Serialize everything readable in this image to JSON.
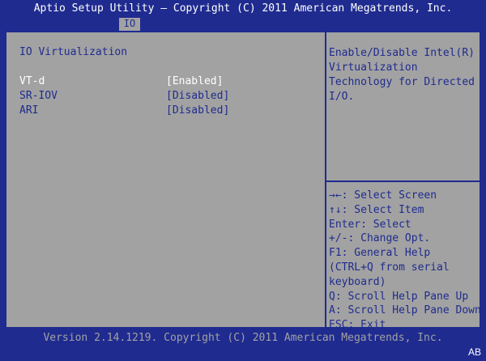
{
  "header": {
    "title": "Aptio Setup Utility – Copyright (C) 2011 American Megatrends, Inc.",
    "tab": "IO"
  },
  "main": {
    "section_title": "IO Virtualization",
    "settings": [
      {
        "label": "VT-d",
        "value": "[Enabled]",
        "selected": true
      },
      {
        "label": "SR-IOV",
        "value": "[Disabled]",
        "selected": false
      },
      {
        "label": "ARI",
        "value": "[Disabled]",
        "selected": false
      }
    ]
  },
  "help": {
    "lines": [
      "Enable/Disable Intel(R)",
      "Virtualization",
      "Technology for Directed",
      "I/O."
    ]
  },
  "keys": {
    "lines": [
      "→←: Select Screen",
      "↑↓: Select Item",
      "Enter: Select",
      "+/-: Change Opt.",
      "F1: General Help",
      "(CTRL+Q from serial",
      "keyboard)",
      "Q: Scroll Help Pane Up",
      "A: Scroll Help Pane Down",
      "ESC: Exit"
    ]
  },
  "footer": {
    "text": "Version 2.14.1219. Copyright (C) 2011 American Megatrends, Inc."
  },
  "badge": "AB",
  "colors": {
    "background": "#1f2b8f",
    "panel": "#a2a2a2",
    "text": "#1f2b8f",
    "highlight": "#ffffff"
  }
}
